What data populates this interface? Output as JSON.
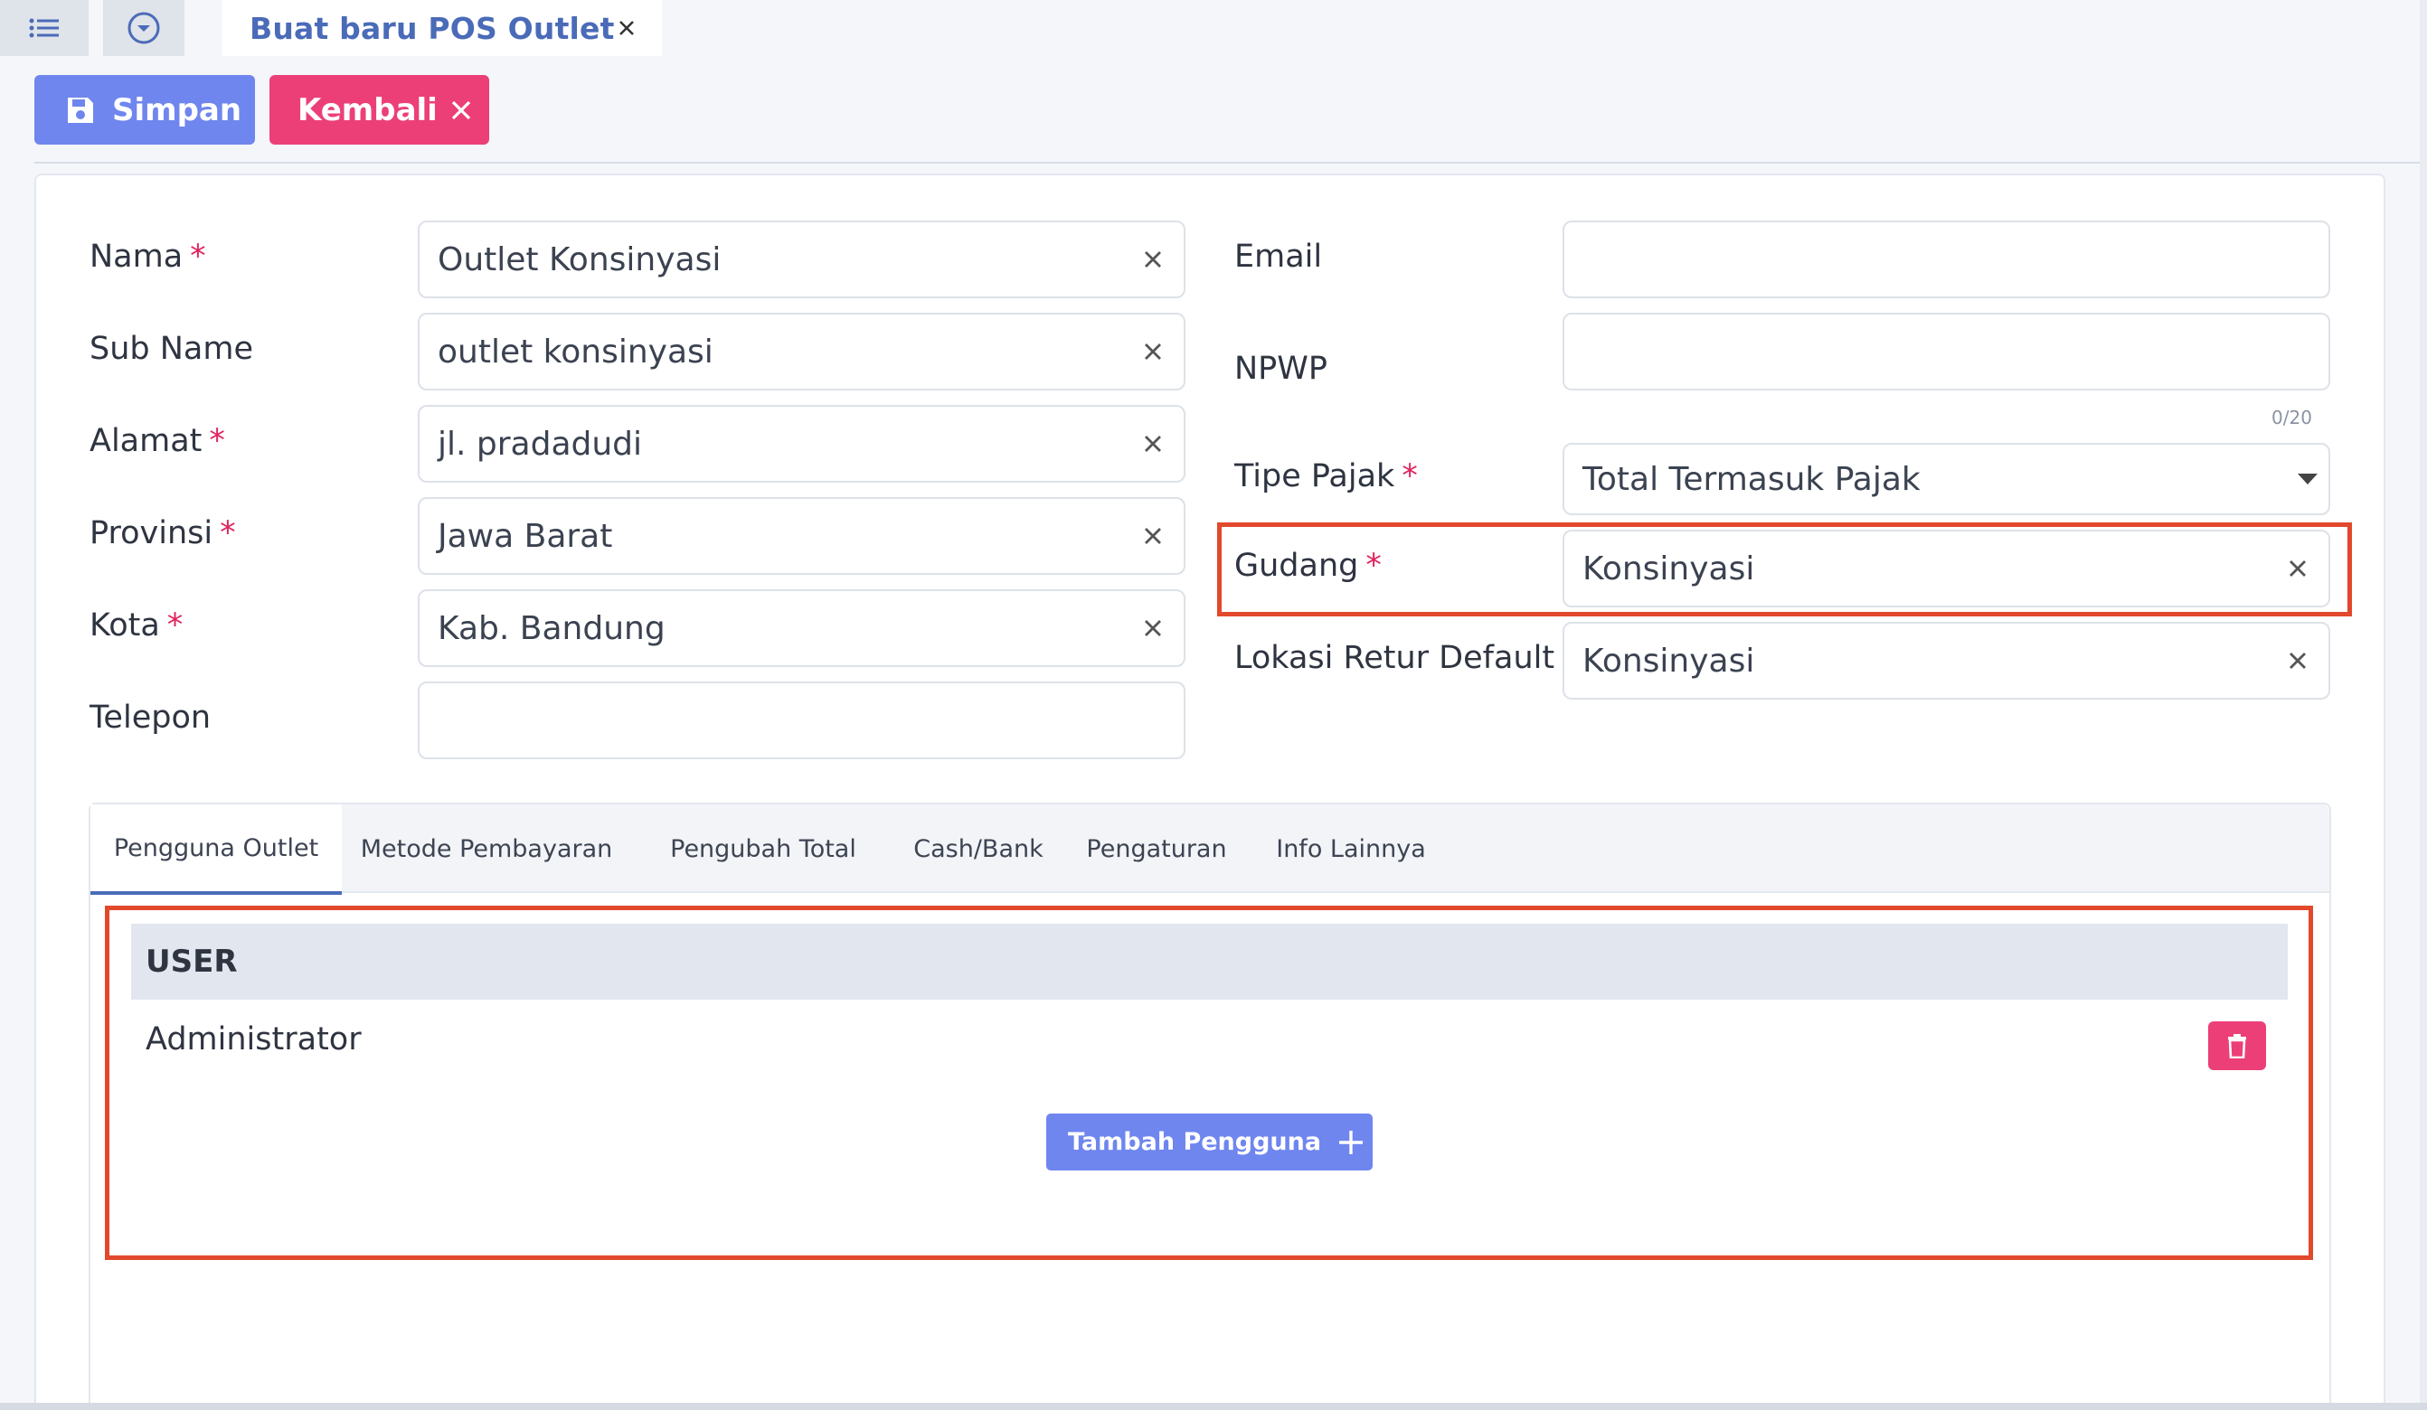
{
  "tabstrip": {
    "menu_icon": "list-icon",
    "dropdown_icon": "chevron-circle-down-icon",
    "doc_tab": {
      "title": "Buat baru POS Outlet",
      "close_icon": "close-icon"
    }
  },
  "toolbar": {
    "save_label": "Simpan",
    "save_icon": "floppy-disk-icon",
    "back_label": "Kembali",
    "back_icon": "close-icon"
  },
  "form": {
    "left": [
      {
        "label": "Nama",
        "required": "*",
        "value": "Outlet Konsinyasi",
        "clearable": true
      },
      {
        "label": "Sub Name",
        "required": "",
        "value": "outlet konsinyasi",
        "clearable": true
      },
      {
        "label": "Alamat",
        "required": "*",
        "value": "jl. pradadudi",
        "clearable": true
      },
      {
        "label": "Provinsi",
        "required": "*",
        "value": "Jawa Barat",
        "clearable": true
      },
      {
        "label": "Kota",
        "required": "*",
        "value": "Kab. Bandung",
        "clearable": true
      },
      {
        "label": "Telepon",
        "required": "",
        "value": "",
        "clearable": false
      }
    ],
    "email": {
      "label": "Email",
      "value": ""
    },
    "npwp": {
      "label": "NPWP",
      "value": "",
      "counter": "0/20"
    },
    "tipe_pajak": {
      "label": "Tipe Pajak",
      "required": "*",
      "value": "Total Termasuk Pajak"
    },
    "gudang": {
      "label": "Gudang",
      "required": "*",
      "value": "Konsinyasi"
    },
    "lokasi_retur": {
      "label": "Lokasi Retur Default",
      "value": "Konsinyasi"
    }
  },
  "tabs": [
    {
      "label": "Pengguna Outlet",
      "active": true
    },
    {
      "label": "Metode Pembayaran",
      "active": false
    },
    {
      "label": "Pengubah Total",
      "active": false
    },
    {
      "label": "Cash/Bank",
      "active": false
    },
    {
      "label": "Pengaturan",
      "active": false
    },
    {
      "label": "Info Lainnya",
      "active": false
    }
  ],
  "users": {
    "header": "USER",
    "rows": [
      {
        "name": "Administrator",
        "delete_icon": "trash-icon"
      }
    ],
    "add_label": "Tambah Pengguna",
    "add_icon": "plus-icon"
  },
  "colors": {
    "primary": "#6f86ef",
    "danger": "#ec3f78",
    "highlight": "#e2482c",
    "tab_title": "#4a6bb8"
  }
}
